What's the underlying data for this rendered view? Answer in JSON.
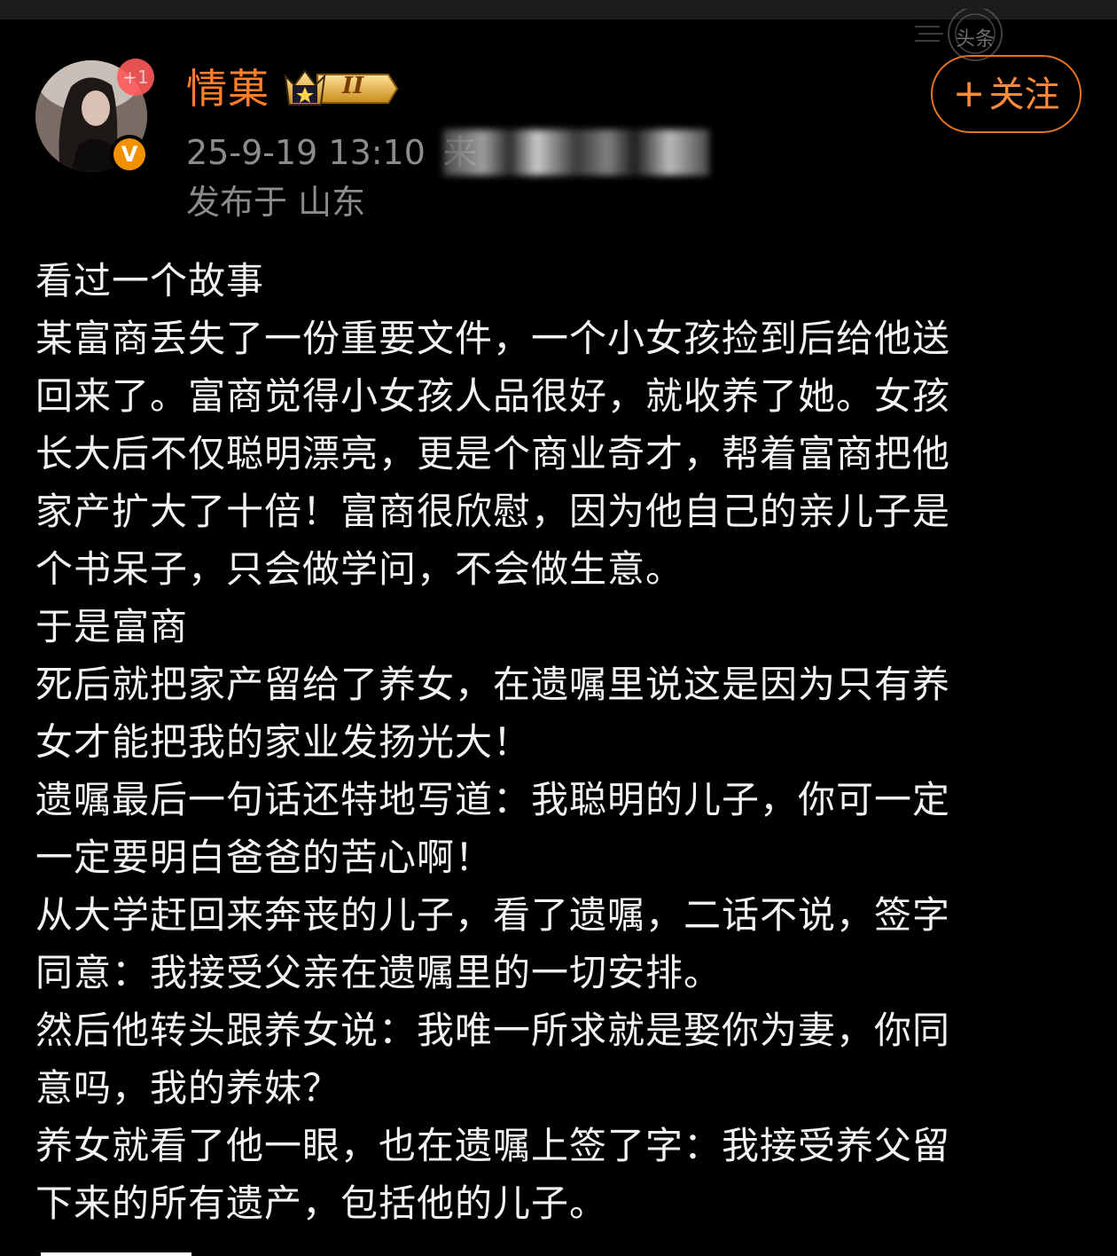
{
  "post": {
    "author": {
      "name": "情菓",
      "level_badge": "II",
      "notification_badge": "+1",
      "verified_badge": "V"
    },
    "timestamp": "25-9-19 13:10",
    "source_prefix": "来",
    "location": "发布于 山东",
    "follow_label": "关注",
    "follow_icon": "+",
    "watermark_text": "头条",
    "lines": [
      "看过一个故事",
      "某富商丢失了一份重要文件，一个小女孩捡到后给他送",
      "回来了。富商觉得小女孩人品很好，就收养了她。女孩",
      "长大后不仅聪明漂亮，更是个商业奇才，帮着富商把他",
      "家产扩大了十倍！富商很欣慰，因为他自己的亲儿子是",
      "个书呆子，只会做学问，不会做生意。",
      "于是富商",
      "死后就把家产留给了养女，在遗嘱里说这是因为只有养",
      "女才能把我的家业发扬光大！",
      "遗嘱最后一句话还特地写道：我聪明的儿子，你可一定",
      "一定要明白爸爸的苦心啊！",
      "从大学赶回来奔丧的儿子，看了遗嘱，二话不说，签字",
      "同意：我接受父亲在遗嘱里的一切安排。",
      "然后他转头跟养女说：我唯一所求就是娶你为妻，你同",
      "意吗，我的养妹？",
      "养女就看了他一眼，也在遗嘱上签了字：我接受养父留",
      "下来的所有遗产，包括他的儿子。"
    ]
  },
  "colors": {
    "background": "#000000",
    "username": "#ff7f2a",
    "meta": "#8c8c8c",
    "body_text": "#f2f2f2",
    "accent": "#e07324"
  }
}
